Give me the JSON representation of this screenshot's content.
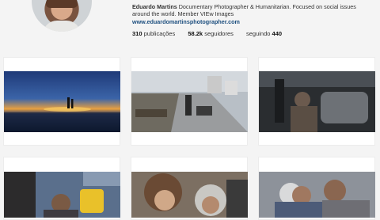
{
  "profile": {
    "name": "Eduardo Martins",
    "bio": "Documentary Photographer & Humanitarian. Focused on social issues around the world. Member VIEw Images",
    "website": "www.eduardomartinsphotographer.com"
  },
  "stats": {
    "posts_count": "310",
    "posts_label": "publicações",
    "followers_count": "58.2k",
    "followers_label": "seguidores",
    "following_label": "seguindo",
    "following_count": "440"
  },
  "posts": [
    {
      "subject": "sunset over sea with silhouetted figures"
    },
    {
      "subject": "street with rubble and walking people"
    },
    {
      "subject": "man in vehicle reflected in window"
    },
    {
      "subject": "child carrying yellow container"
    },
    {
      "subject": "girl with curly hair embracing woman"
    },
    {
      "subject": "women embracing"
    }
  ]
}
